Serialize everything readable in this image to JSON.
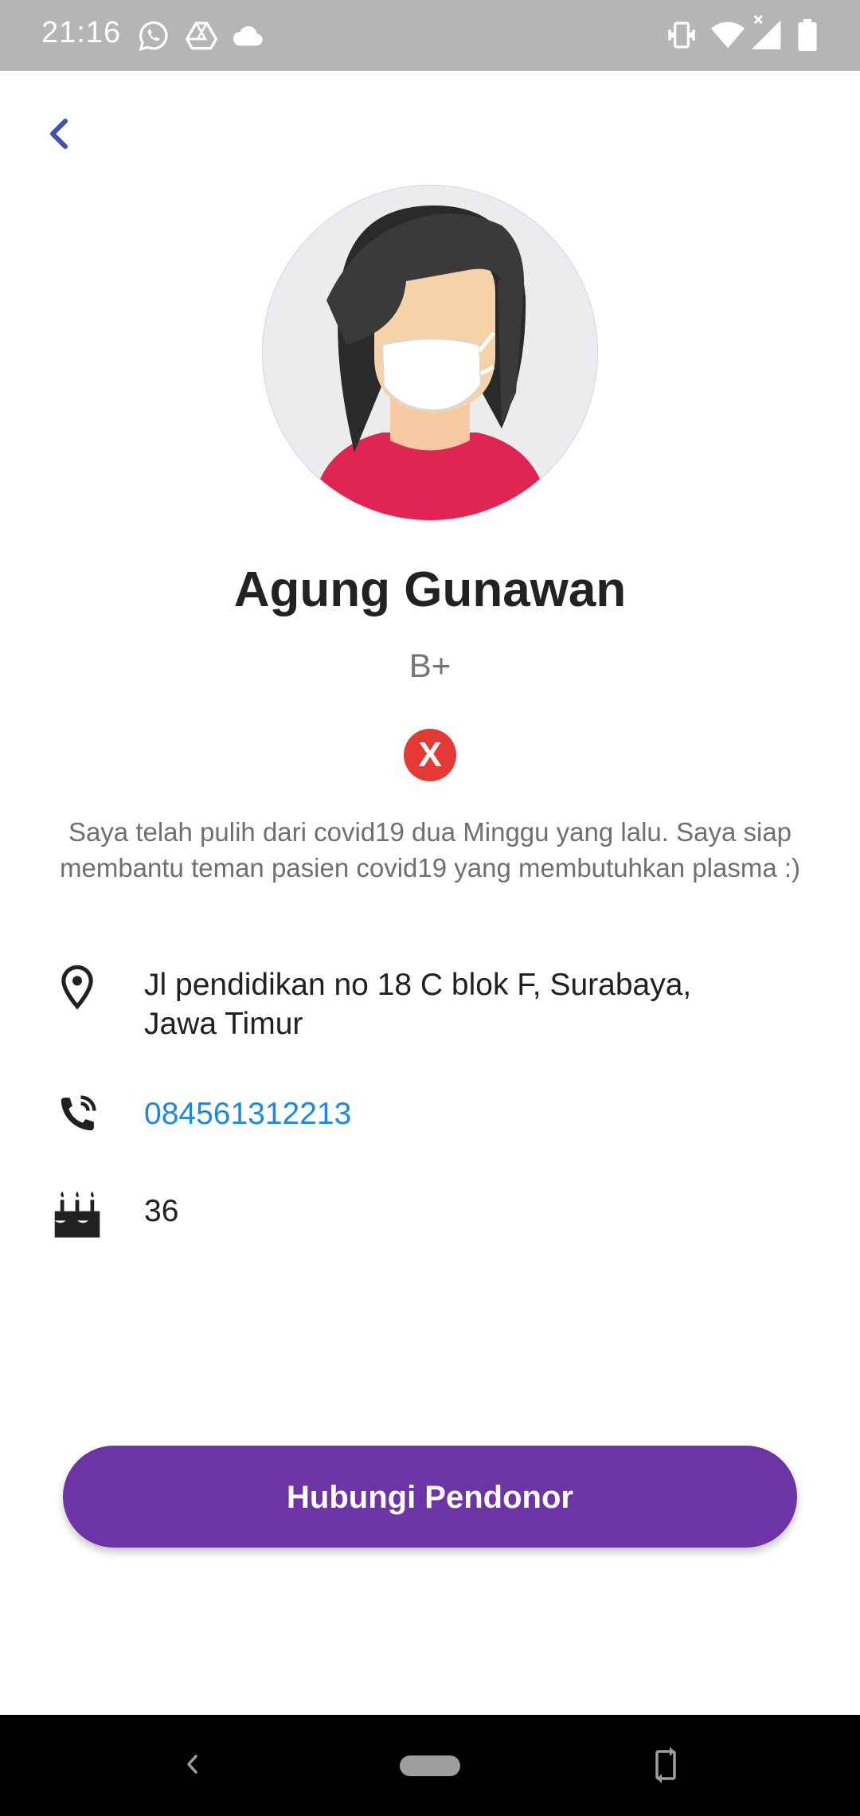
{
  "status_bar": {
    "time": "21:16",
    "icons": [
      "whatsapp-icon",
      "drive-icon",
      "cloud-icon",
      "vibrate-icon",
      "wifi-icon",
      "signal-icon",
      "battery-icon"
    ]
  },
  "header": {
    "back_icon": "chevron-left-icon"
  },
  "profile": {
    "name": "Agung Gunawan",
    "blood_type": "B+",
    "status_badge": "X",
    "description": "Saya telah pulih dari covid19 dua Minggu yang lalu. Saya siap membantu teman pasien covid19 yang membutuhkan plasma :)"
  },
  "details": {
    "address": {
      "icon": "location-pin-icon",
      "line1": "Jl pendidikan no 18 C blok F, Surabaya,",
      "line2": "Jawa Timur"
    },
    "phone": {
      "icon": "phone-call-icon",
      "value": "084561312213"
    },
    "age": {
      "icon": "birthday-cake-icon",
      "value": "36"
    }
  },
  "actions": {
    "contact_label": "Hubungi Pendonor"
  },
  "colors": {
    "accent": "#6c34a4",
    "back_arrow": "#3f51b5",
    "link": "#1e88e5",
    "badge": "#e53935",
    "shirt": "#e02552"
  },
  "nav_bar": {
    "icons": [
      "nav-back-icon",
      "nav-home-pill",
      "rotate-icon"
    ]
  }
}
